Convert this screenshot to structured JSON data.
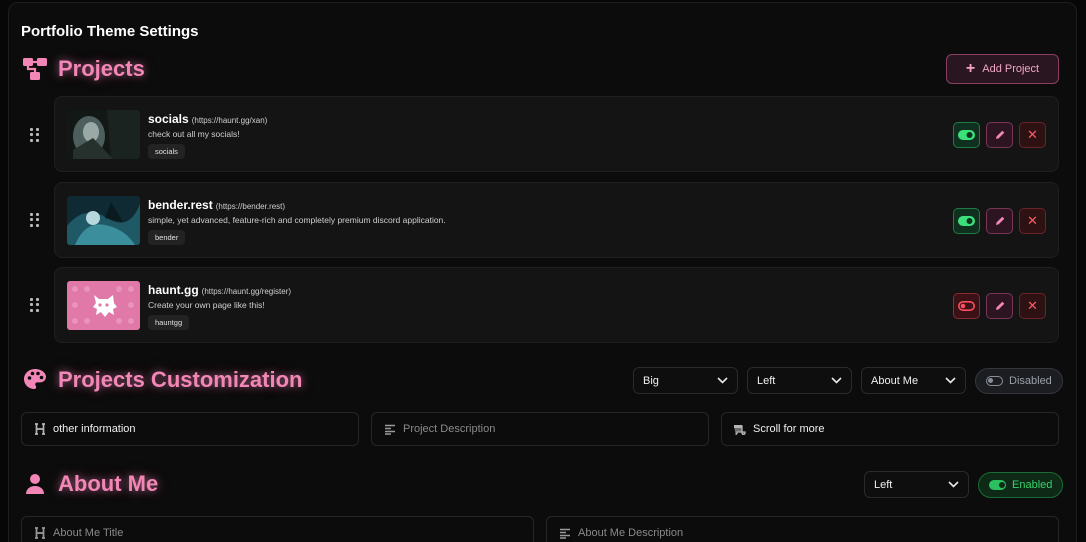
{
  "page": {
    "title": "Portfolio Theme Settings"
  },
  "colors": {
    "accent": "#f287b7",
    "enabled": "#2bbf60",
    "danger": "#ff5a66"
  },
  "projects_section": {
    "title": "Projects",
    "icon": "sitemap-icon",
    "add_button": "Add Project",
    "items": [
      {
        "name": "socials",
        "url": "(https://haunt.gg/xan)",
        "description": "check out all my socials!",
        "tag": "socials",
        "enabled": true,
        "thumb": "dark-portrait"
      },
      {
        "name": "bender.rest",
        "url": "(https://bender.rest)",
        "description": "simple, yet advanced, feature-rich and completely premium discord application.",
        "tag": "bender",
        "enabled": true,
        "thumb": "teal-anime"
      },
      {
        "name": "haunt.gg",
        "url": "(https://haunt.gg/register)",
        "description": "Create your own page like this!",
        "tag": "hauntgg",
        "enabled": false,
        "thumb": "pink-ghost-logo"
      }
    ]
  },
  "customization_section": {
    "title": "Projects Customization",
    "icon": "palette-icon",
    "selects": [
      "Big",
      "Left",
      "About Me"
    ],
    "toggle_label": "Disabled",
    "fields": [
      {
        "icon": "heading-icon",
        "value": "other information",
        "placeholder": ""
      },
      {
        "icon": "align-left-icon",
        "value": "",
        "placeholder": "Project Description"
      },
      {
        "icon": "scroll-icon",
        "value": "Scroll for more",
        "placeholder": ""
      }
    ]
  },
  "about_section": {
    "title": "About Me",
    "icon": "user-icon",
    "select": "Left",
    "toggle_label": "Enabled",
    "fields": [
      {
        "icon": "heading-icon",
        "placeholder": "About Me Title"
      },
      {
        "icon": "align-left-icon",
        "placeholder": "About Me Description"
      }
    ]
  }
}
